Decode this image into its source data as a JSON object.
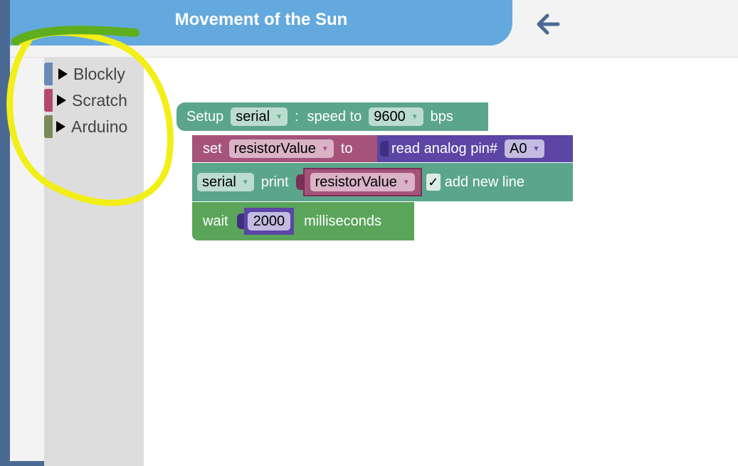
{
  "header": {
    "title": "Movement of the Sun",
    "back_icon": "arrow-left-icon"
  },
  "toolbox": {
    "categories": [
      {
        "label": "Blockly",
        "color": "#6a8ab3"
      },
      {
        "label": "Scratch",
        "color": "#b3496e"
      },
      {
        "label": "Arduino",
        "color": "#7a8a5a"
      }
    ]
  },
  "blocks": {
    "setup": {
      "setup_label": "Setup",
      "serial_value": "serial",
      "colon": ":",
      "speed_label": "speed to",
      "speed_value": "9600",
      "bps_label": "bps"
    },
    "set": {
      "set_label": "set",
      "variable": "resistorValue",
      "to_label": "to",
      "read_label": "read analog pin#",
      "pin_value": "A0"
    },
    "print": {
      "serial_value": "serial",
      "print_label": "print",
      "variable": "resistorValue",
      "check_mark": "✓",
      "newline_label": "add new line"
    },
    "wait": {
      "wait_label": "wait",
      "ms_value": "2000",
      "ms_label": "milliseconds"
    }
  },
  "colors": {
    "title_bar": "#64a9dd",
    "frame": "#4a6a94",
    "highlight_yellow": "#f2ee17",
    "highlight_green": "#5fae1e",
    "block_setup": "#5ba58c",
    "block_set": "#a5537a",
    "block_read": "#5b45a5",
    "block_print": "#5ba58c",
    "block_wait": "#5ba55b"
  }
}
